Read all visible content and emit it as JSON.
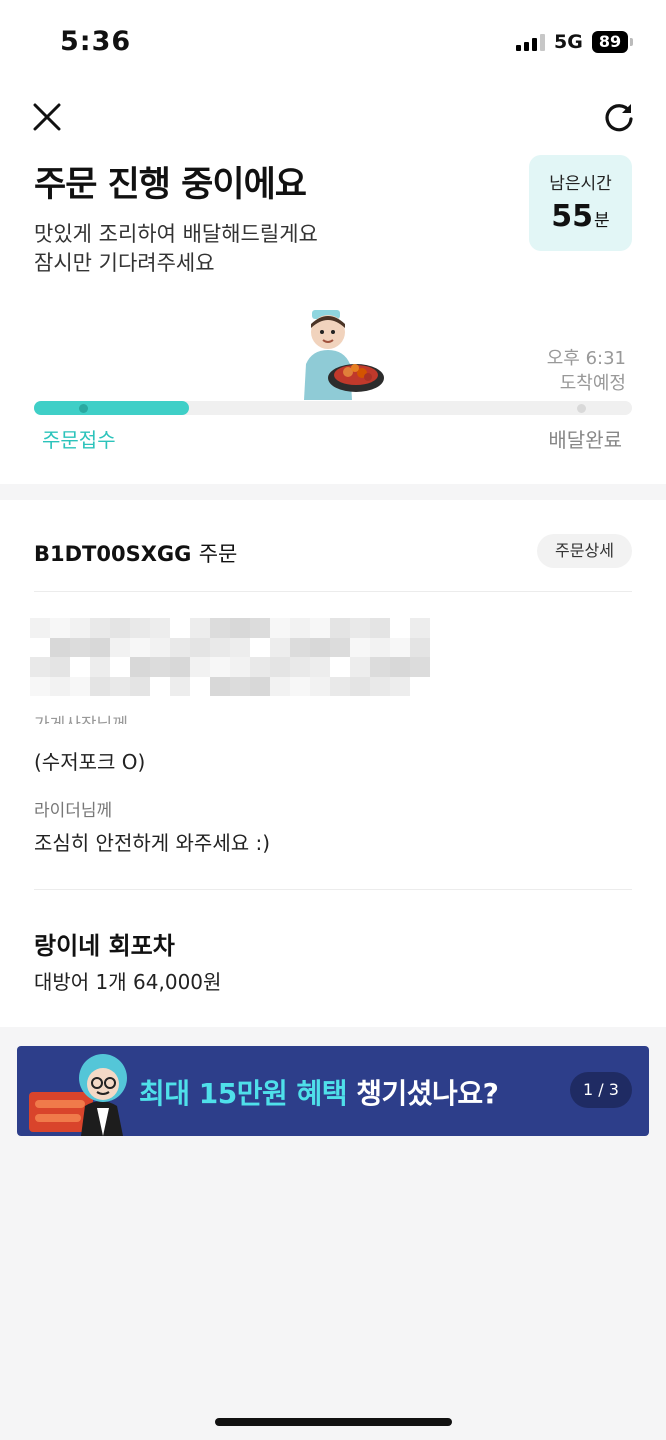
{
  "status_bar": {
    "time": "5:36",
    "network": "5G",
    "battery": "89"
  },
  "header": {
    "title": "주문 진행 중이에요",
    "subtitle_line1": "맛있게 조리하여 배달해드릴게요",
    "subtitle_line2": "잠시만 기다려주세요"
  },
  "remaining": {
    "label": "남은시간",
    "value": "55",
    "unit": "분"
  },
  "progress": {
    "fraction": 0.26,
    "start_label": "주문접수",
    "end_label": "배달완료",
    "eta_time": "오후 6:31",
    "eta_label": "도착예정"
  },
  "order": {
    "id_text": "B1DT00SXGG",
    "id_suffix": "주문",
    "detail_button": "주문상세",
    "store_note_label": "가게사장님께",
    "store_note": "(수저포크 O)",
    "rider_note_label": "라이더님께",
    "rider_note": "조심히 안전하게 와주세요 :)",
    "store_name": "랑이네 회포차",
    "menu_line": "대방어 1개 64,000원"
  },
  "banner": {
    "highlight": "최대 15만원 혜택",
    "rest": "챙기셨나요?",
    "pager": "1 / 3"
  },
  "colors": {
    "accent": "#3fcfc7",
    "banner_bg": "#2d3e8a",
    "time_box_bg": "#e2f6f6"
  }
}
